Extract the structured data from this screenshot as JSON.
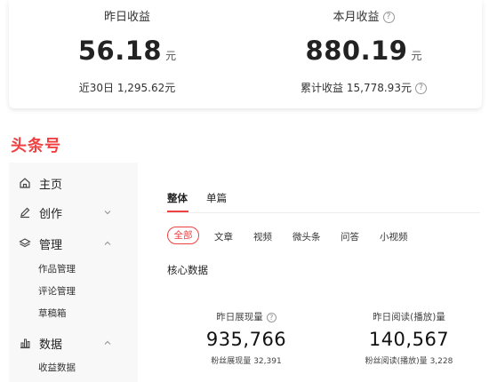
{
  "earnings": {
    "yesterday": {
      "label": "昨日收益",
      "value": "56.18",
      "unit": "元",
      "sub_label": "近30日",
      "sub_value": "1,295.62元"
    },
    "month": {
      "label": "本月收益",
      "value": "880.19",
      "unit": "元",
      "sub_label": "累计收益",
      "sub_value": "15,778.93元"
    },
    "help_glyph": "?"
  },
  "brand": {
    "logo_text": "头条号",
    "color": "#f04142"
  },
  "sidebar": {
    "items": [
      {
        "label": "主页",
        "icon": "home-icon"
      },
      {
        "label": "创作",
        "icon": "pencil-icon"
      },
      {
        "label": "管理",
        "icon": "layers-icon"
      },
      {
        "label": "作品管理"
      },
      {
        "label": "评论管理"
      },
      {
        "label": "草稿箱"
      },
      {
        "label": "数据",
        "icon": "bar-chart-icon"
      },
      {
        "label": "收益数据"
      }
    ]
  },
  "content": {
    "tabs": [
      "整体",
      "单篇"
    ],
    "filters": [
      "全部",
      "文章",
      "视频",
      "微头条",
      "问答",
      "小视频"
    ],
    "section_title": "核心数据",
    "metrics": [
      {
        "label": "昨日展现量",
        "value": "935,766",
        "sub_label": "粉丝展现量",
        "sub_value": "32,391"
      },
      {
        "label": "昨日阅读(播放)量",
        "value": "140,567",
        "sub_label": "粉丝阅读(播放)量",
        "sub_value": "3,228"
      }
    ]
  }
}
